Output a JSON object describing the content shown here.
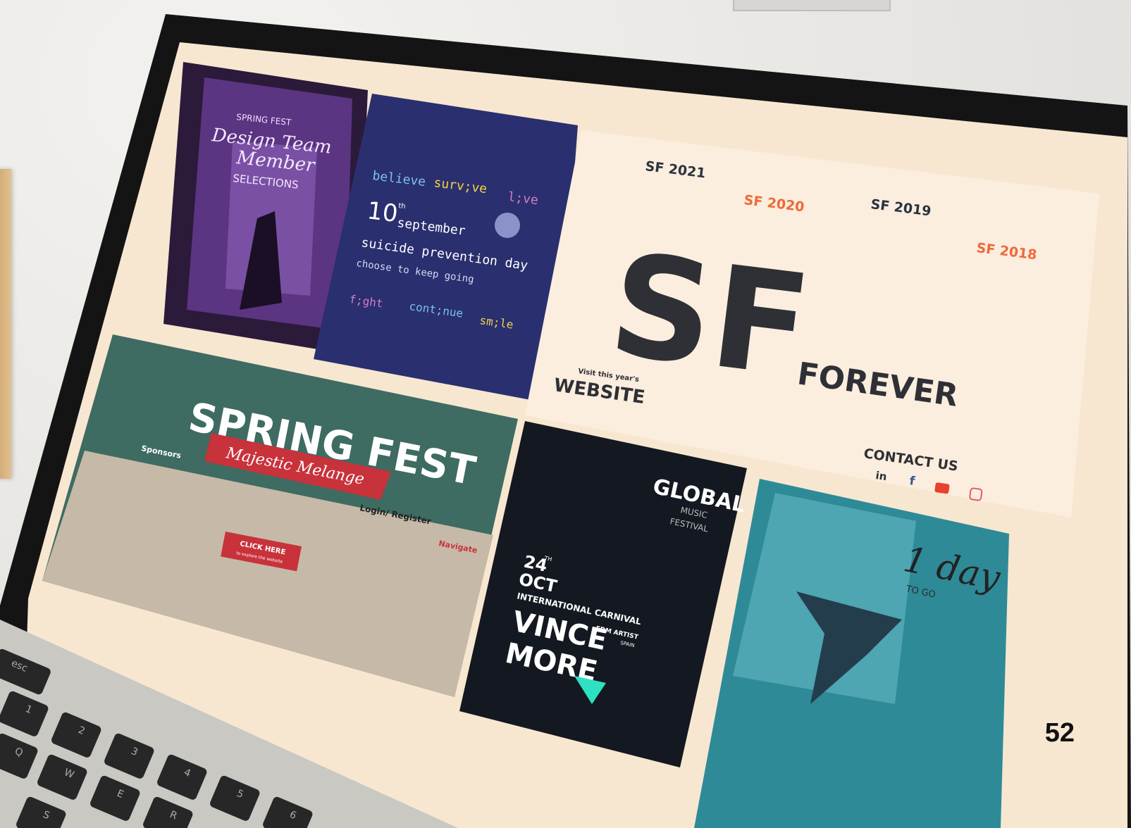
{
  "page_number": "52",
  "posters": {
    "design_team": {
      "line1": "SPRING FEST",
      "line2": "Design Team",
      "line3": "Member",
      "line4": "SELECTIONS"
    },
    "suicide_prevention": {
      "word1": "believe",
      "word2": "surv;ve",
      "word3": "l;ve",
      "date_num": "10",
      "date_sup": "th",
      "date_month": "september",
      "title1": "suicide prevention day",
      "title2": "choose to keep going",
      "word4": "f;ght",
      "word5": "cont;nue",
      "word6": "sm;le"
    },
    "sf_forever": {
      "sf2021": "SF 2021",
      "sf2020": "SF 2020",
      "sf2019": "SF 2019",
      "sf2018": "SF 2018",
      "big": "SF",
      "forever": "FOREVER",
      "visit_small": "Visit this year's",
      "website": "WEBSITE",
      "contact": "CONTACT US",
      "social_in": "in",
      "social_f": "f"
    },
    "spring_fest": {
      "title": "SPRING FEST",
      "subtitle": "Majestic Melange",
      "sponsors": "Sponsors",
      "login": "Login/ Register",
      "navigate": "Navigate",
      "click_here": "CLICK HERE",
      "click_sub": "to explore the website"
    },
    "global_music": {
      "line1": "GLOBAL",
      "line2": "MUSIC",
      "line3": "FESTIVAL",
      "date": "24",
      "date_sup": "TH",
      "month": "OCT",
      "carnival": "INTERNATIONAL CARNIVAL",
      "name1": "VINCE",
      "name2": "MORE",
      "edm": "EDM ARTIST",
      "spain": "SPAIN"
    },
    "one_day": {
      "big": "1 day",
      "small": "TO GO"
    }
  },
  "keyboard": {
    "keys": [
      "esc",
      "1",
      "2",
      "3",
      "4",
      "5",
      "6",
      "Q",
      "W",
      "E",
      "R",
      "S"
    ]
  }
}
